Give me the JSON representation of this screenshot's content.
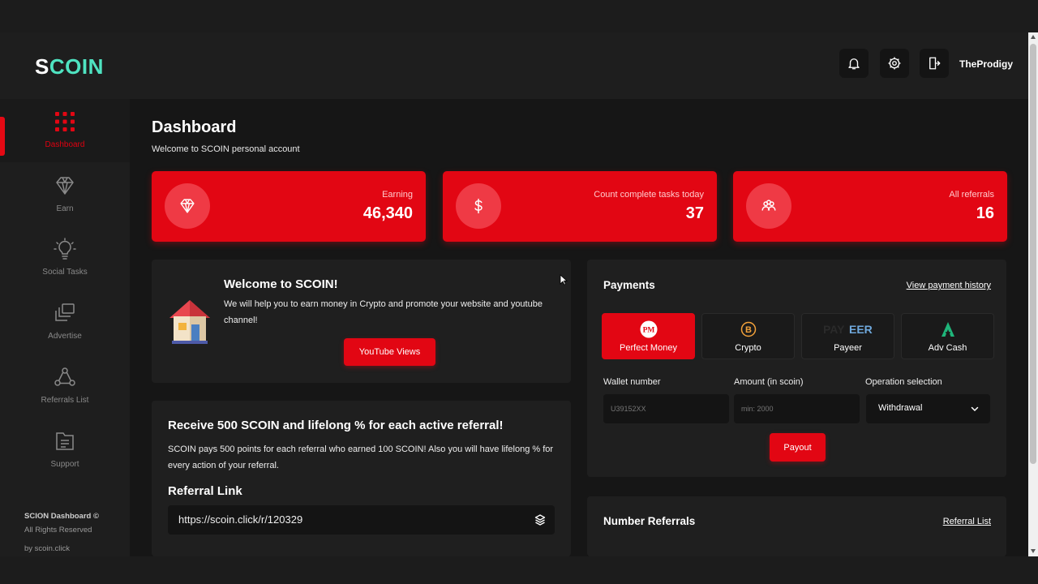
{
  "header": {
    "logo_first": "S",
    "logo_rest": "COIN",
    "username": "TheProdigy",
    "icons": [
      "bell-icon",
      "gear-icon",
      "logout-icon"
    ]
  },
  "sidebar": {
    "items": [
      {
        "label": "Dashboard",
        "icon": "grid-icon",
        "active": true
      },
      {
        "label": "Earn",
        "icon": "diamond-icon",
        "active": false
      },
      {
        "label": "Social Tasks",
        "icon": "lightbulb-icon",
        "active": false
      },
      {
        "label": "Advertise",
        "icon": "layers-icon",
        "active": false
      },
      {
        "label": "Referrals List",
        "icon": "referral-network-icon",
        "active": false
      },
      {
        "label": "Support",
        "icon": "document-icon",
        "active": false
      }
    ],
    "footer": {
      "title": "SCION Dashboard ©",
      "rights": "All Rights Reserved",
      "by": "by scoin.click"
    }
  },
  "main": {
    "title": "Dashboard",
    "subtitle": "Welcome to SCOIN personal account",
    "stats": [
      {
        "label": "Earning",
        "value": "46,340",
        "icon": "diamond-icon"
      },
      {
        "label": "Count complete tasks today",
        "value": "37",
        "icon": "dollar-icon"
      },
      {
        "label": "All referrals",
        "value": "16",
        "icon": "users-icon"
      }
    ],
    "welcome": {
      "title": "Welcome to SCOIN!",
      "text": "We will help you to earn money in Crypto and promote your website and youtube channel!",
      "button": "YouTube Views"
    },
    "referral": {
      "title": "Receive 500 SCOIN and lifelong % for each active referral!",
      "text": "SCOIN pays 500 points for each referral who earned 100 SCOIN! Also you will have lifelong % for every action of your referral.",
      "link_label": "Referral Link",
      "link": "https://scoin.click/r/120329"
    },
    "payments": {
      "title": "Payments",
      "history_link": "View payment history",
      "methods": [
        {
          "label": "Perfect Money",
          "icon": "perfect-money-icon",
          "active": true
        },
        {
          "label": "Crypto",
          "icon": "bitcoin-icon",
          "active": false
        },
        {
          "label": "Payeer",
          "icon": "payeer-icon",
          "active": false
        },
        {
          "label": "Adv Cash",
          "icon": "advcash-icon",
          "active": false
        }
      ],
      "wallet_label": "Wallet number",
      "wallet_placeholder": "U39152XX",
      "amount_label": "Amount (in scoin)",
      "amount_placeholder": "min: 2000",
      "operation_label": "Operation selection",
      "operation_value": "Withdrawal",
      "payout_button": "Payout"
    },
    "number_referrals": {
      "title": "Number Referrals",
      "link": "Referral List"
    }
  },
  "colors": {
    "accent": "#e20613",
    "logo_teal": "#4fe3c1",
    "background": "#161616",
    "card": "#1f1f1f"
  }
}
